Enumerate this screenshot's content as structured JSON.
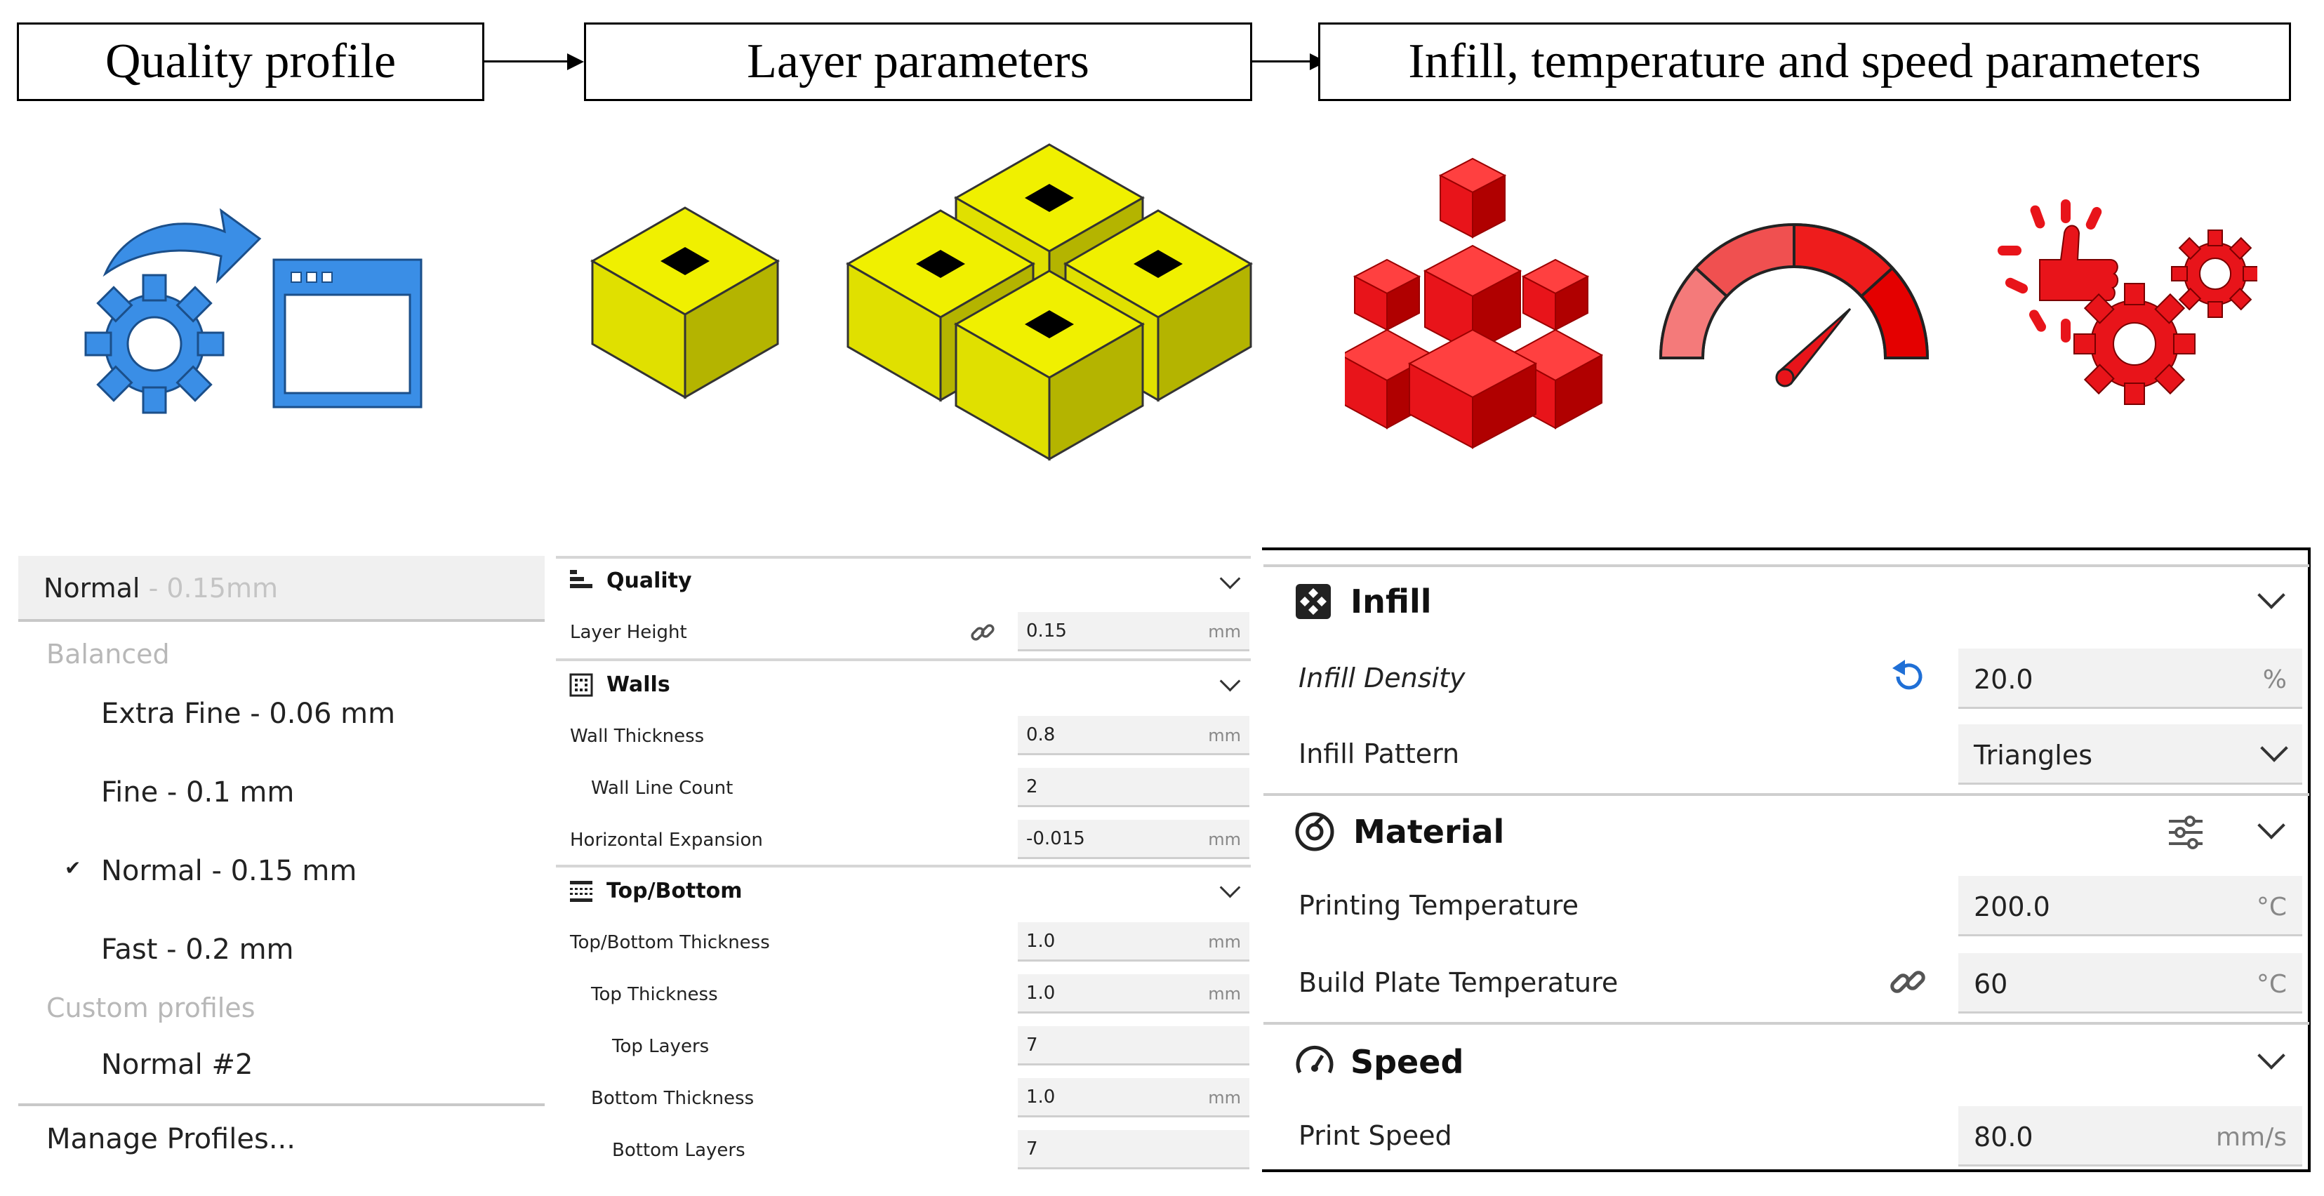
{
  "flow": {
    "step1": "Quality profile",
    "step2": "Layer parameters",
    "step3": "Infill, temperature and speed parameters"
  },
  "colors": {
    "blue_icon": "#3a8ee6",
    "yellow_cube": "#e6e600",
    "red_icon": "#e8141a",
    "accent_blue": "#1f6fd6"
  },
  "icons": {
    "quality": "gear-window-arrow-icon",
    "layer_single": "single-cube-icon",
    "layer_multi": "multi-cube-icon",
    "infill": "red-cubes-icon",
    "temperature": "speedometer-icon",
    "speed": "gears-thumbs-up-icon"
  },
  "profile_panel": {
    "current_name": "Normal",
    "current_suffix": " - 0.15mm",
    "group_balanced": "Balanced",
    "items": [
      {
        "label": "Extra Fine - 0.06 mm",
        "checked": false
      },
      {
        "label": "Fine - 0.1 mm",
        "checked": false
      },
      {
        "label": "Normal - 0.15 mm",
        "checked": true
      },
      {
        "label": "Fast - 0.2 mm",
        "checked": false
      }
    ],
    "group_custom": "Custom profiles",
    "custom_items": [
      {
        "label": "Normal #2"
      }
    ],
    "manage": "Manage Profiles..."
  },
  "layer_panel": {
    "quality_title": "Quality",
    "layer_height_label": "Layer Height",
    "layer_height_value": "0.15",
    "walls_title": "Walls",
    "wall_thickness_label": "Wall Thickness",
    "wall_thickness_value": "0.8",
    "wall_line_count_label": "Wall Line Count",
    "wall_line_count_value": "2",
    "horizontal_expansion_label": "Horizontal Expansion",
    "horizontal_expansion_value": "-0.015",
    "topbottom_title": "Top/Bottom",
    "tb_thickness_label": "Top/Bottom Thickness",
    "tb_thickness_value": "1.0",
    "top_thickness_label": "Top Thickness",
    "top_thickness_value": "1.0",
    "top_layers_label": "Top Layers",
    "top_layers_value": "7",
    "bottom_thickness_label": "Bottom Thickness",
    "bottom_thickness_value": "1.0",
    "bottom_layers_label": "Bottom Layers",
    "bottom_layers_value": "7",
    "unit_mm": "mm"
  },
  "infill_panel": {
    "infill_title": "Infill",
    "infill_density_label": "Infill Density",
    "infill_density_value": "20.0",
    "infill_density_unit": "%",
    "infill_pattern_label": "Infill Pattern",
    "infill_pattern_value": "Triangles",
    "material_title": "Material",
    "print_temp_label": "Printing Temperature",
    "print_temp_value": "200.0",
    "temp_unit": "°C",
    "bed_temp_label": "Build Plate Temperature",
    "bed_temp_value": "60",
    "speed_title": "Speed",
    "print_speed_label": "Print Speed",
    "print_speed_value": "80.0",
    "speed_unit": "mm/s"
  }
}
